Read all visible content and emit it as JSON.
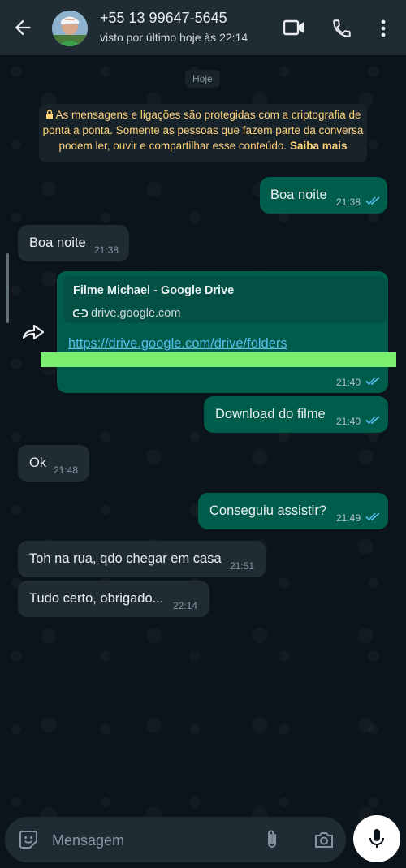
{
  "header": {
    "contact_name": "+55 13 99647-5645",
    "status": "visto por último hoje às 22:14",
    "icons": [
      "back-arrow-icon",
      "video-call-icon",
      "voice-call-icon",
      "more-options-icon"
    ]
  },
  "date_chip": "Hoje",
  "encryption_notice": {
    "text": "As mensagens e ligações são protegidas com a criptografia de ponta a ponta. Somente as pessoas que fazem parte da conversa podem ler, ouvir e compartilhar esse conteúdo.",
    "link": "Saiba mais"
  },
  "messages": [
    {
      "direction": "out",
      "text": "Boa noite",
      "time": "21:38",
      "read": true
    },
    {
      "direction": "in",
      "text": "Boa noite",
      "time": "21:38"
    },
    {
      "direction": "out",
      "preview_title": "Filme Michael - Google Drive",
      "preview_domain": "drive.google.com",
      "link": "https://drive.google.com/drive/folders",
      "time": "21:40",
      "read": true
    },
    {
      "direction": "out",
      "text": "Download do filme",
      "time": "21:40",
      "read": true
    },
    {
      "direction": "in",
      "text": "Ok",
      "time": "21:48"
    },
    {
      "direction": "out",
      "text": "Conseguiu assistir?",
      "time": "21:49",
      "read": true
    },
    {
      "direction": "in",
      "text": "Toh na rua, qdo chegar em casa",
      "time": "21:51"
    },
    {
      "direction": "in",
      "text": "Tudo certo, obrigado...",
      "time": "22:14"
    }
  ],
  "input": {
    "placeholder": "Mensagem"
  },
  "colors": {
    "outgoing_bubble": "#005c4b",
    "incoming_bubble": "#202c33",
    "read_ticks": "#53bdeb",
    "notice_text": "#ffd279"
  }
}
